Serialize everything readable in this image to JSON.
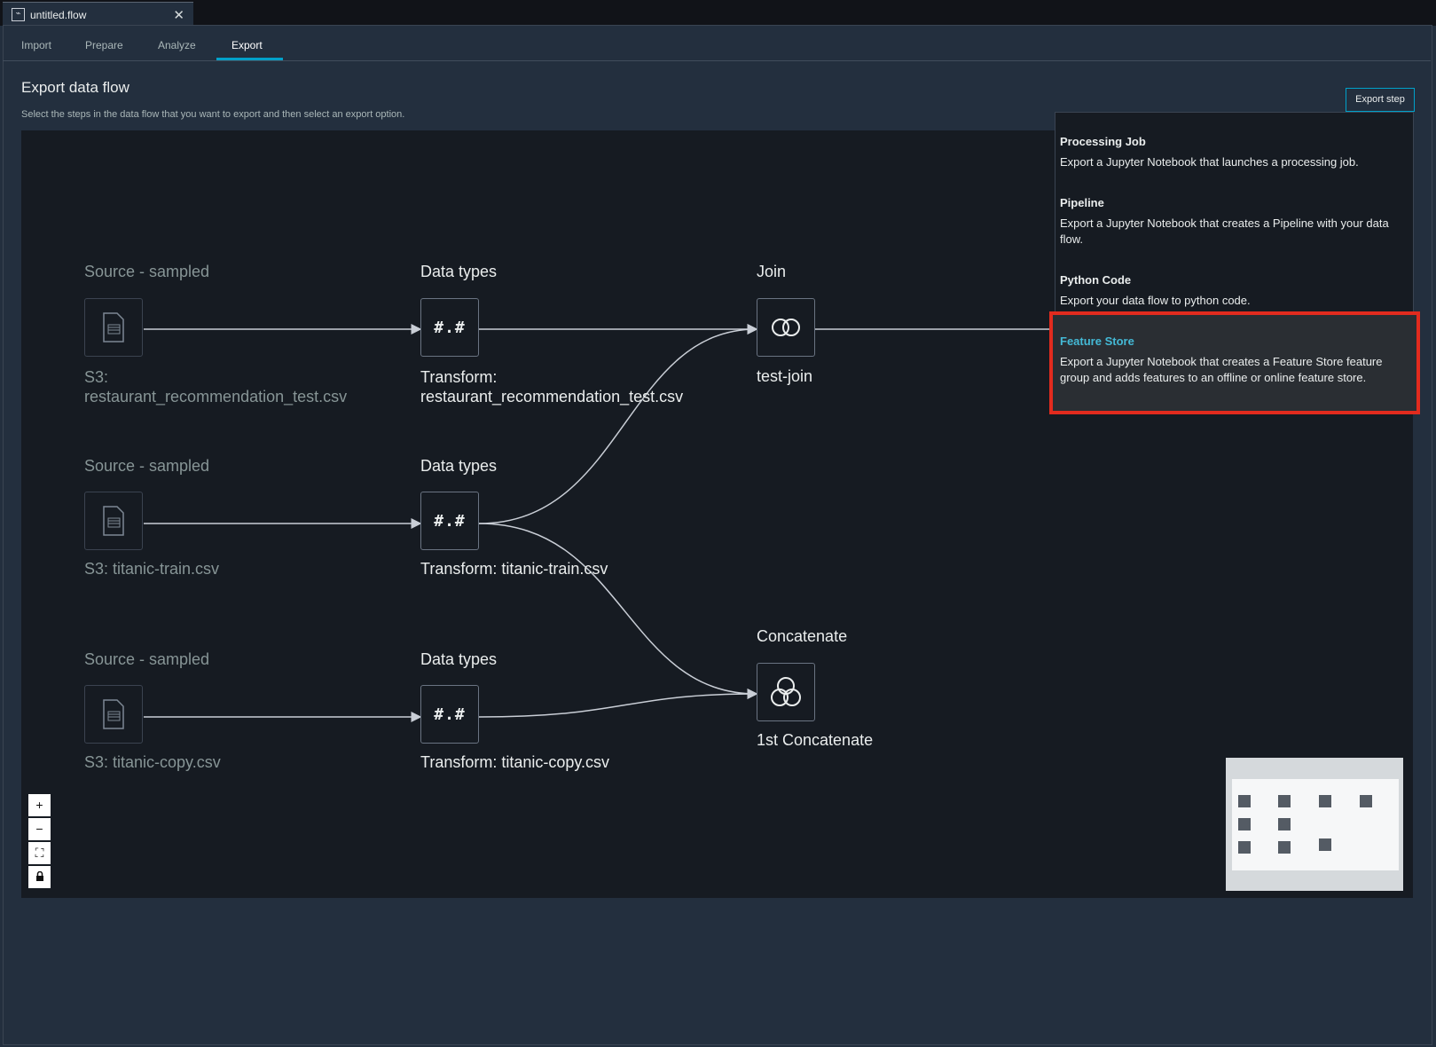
{
  "window": {
    "file_tab": "untitled.flow",
    "close_glyph": "✕"
  },
  "nav": {
    "tabs": [
      "Import",
      "Prepare",
      "Analyze",
      "Export"
    ],
    "active": "Export"
  },
  "header": {
    "title": "Export data flow",
    "subtitle": "Select the steps in the data flow that you want to export and then select an export option.",
    "export_button": "Export step"
  },
  "flow": {
    "row1": {
      "source_title": "Source - sampled",
      "source_name": "S3:",
      "source_name2": "restaurant_recommendation_test.csv",
      "dtype_title": "Data types",
      "dtype_name": "Transform:",
      "dtype_name2": "restaurant_recommendation_test.csv"
    },
    "row2": {
      "source_title": "Source - sampled",
      "source_name": "S3: titanic-train.csv",
      "dtype_title": "Data types",
      "dtype_name": "Transform: titanic-train.csv"
    },
    "row3": {
      "source_title": "Source - sampled",
      "source_name": "S3: titanic-copy.csv",
      "dtype_title": "Data types",
      "dtype_name": "Transform: titanic-copy.csv"
    },
    "join": {
      "title": "Join",
      "name": "test-join"
    },
    "concat": {
      "title": "Concatenate",
      "name": "1st Concatenate"
    },
    "dtype_glyph": "#.#"
  },
  "zoom_controls": {
    "plus": "+",
    "minus": "−",
    "fit": "⛶",
    "lock": "🔒"
  },
  "export_menu": {
    "items": [
      {
        "title": "Processing Job",
        "desc": "Export a Jupyter Notebook that launches a processing job."
      },
      {
        "title": "Pipeline",
        "desc": "Export a Jupyter Notebook that creates a Pipeline with your data flow."
      },
      {
        "title": "Python Code",
        "desc": "Export your data flow to python code."
      },
      {
        "title": "Feature Store",
        "desc": "Export a Jupyter Notebook that creates a Feature Store feature group and adds features to an offline or online feature store."
      }
    ],
    "selected": "Feature Store"
  },
  "colors": {
    "accent": "#00a1c9",
    "highlight": "#e22b1e"
  }
}
